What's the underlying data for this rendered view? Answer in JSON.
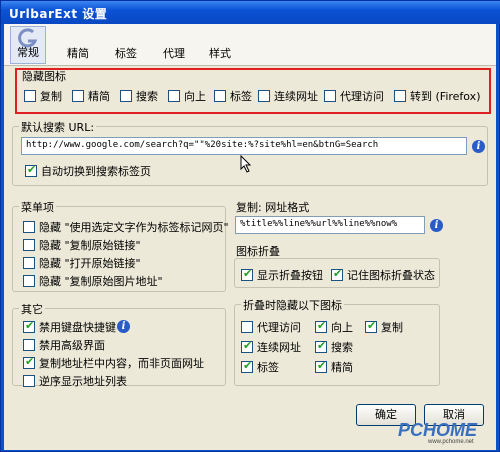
{
  "window": {
    "title": "UrlbarExt 设置"
  },
  "toolbar": {
    "tabs": [
      {
        "label": "常规",
        "active": true
      },
      {
        "label": "精简"
      },
      {
        "label": "标签"
      },
      {
        "label": "代理"
      },
      {
        "label": "样式"
      }
    ]
  },
  "hide_icons": {
    "title": "隐藏图标",
    "items": [
      {
        "label": "复制",
        "checked": false
      },
      {
        "label": "精简",
        "checked": false
      },
      {
        "label": "搜索",
        "checked": false
      },
      {
        "label": "向上",
        "checked": false
      },
      {
        "label": "标签",
        "checked": false
      },
      {
        "label": "连续网址",
        "checked": false
      },
      {
        "label": "代理访问",
        "checked": false
      },
      {
        "label": "转到 (Firefox)",
        "checked": false
      }
    ]
  },
  "search": {
    "title": "默认搜索 URL:",
    "url": "http://www.google.com/search?q=\"\"%20site:%?site%hl=en&btnG=Search",
    "auto_switch": {
      "label": "自动切换到搜索标签页",
      "checked": true
    }
  },
  "menu_items": {
    "title": "菜单项",
    "items": [
      {
        "label": "隐藏 \"使用选定文字作为标签标记网页\"",
        "checked": false
      },
      {
        "label": "隐藏 \"复制原始链接\"",
        "checked": false
      },
      {
        "label": "隐藏 \"打开原始链接\"",
        "checked": false
      },
      {
        "label": "隐藏 \"复制原始图片地址\"",
        "checked": false
      }
    ]
  },
  "copy_format": {
    "title": "复制: 网址格式",
    "value": "%title%%line%%url%%line%%now%"
  },
  "icon_fold": {
    "title": "图标折叠",
    "show_fold_button": {
      "label": "显示折叠按钮",
      "checked": true
    },
    "remember_state": {
      "label": "记住图标折叠状态",
      "checked": true
    }
  },
  "fold_hide": {
    "title": "折叠时隐藏以下图标",
    "items": [
      {
        "label": "代理访问",
        "checked": false
      },
      {
        "label": "向上",
        "checked": true
      },
      {
        "label": "复制",
        "checked": true
      },
      {
        "label": "连续网址",
        "checked": true
      },
      {
        "label": "搜索",
        "checked": true
      },
      {
        "label": "标签",
        "checked": true
      },
      {
        "label": "精简",
        "checked": true
      }
    ]
  },
  "other": {
    "title": "其它",
    "items": [
      {
        "label": "禁用键盘快捷键",
        "checked": true
      },
      {
        "label": "禁用高级界面",
        "checked": false
      },
      {
        "label": "复制地址栏中内容，而非页面网址",
        "checked": true
      },
      {
        "label": "逆序显示地址列表",
        "checked": false
      }
    ]
  },
  "buttons": {
    "ok": "确定",
    "cancel": "取消"
  },
  "watermark": {
    "text": "PCHOME",
    "sub": "www.pchome.net"
  },
  "colors": {
    "titlebar": "#0a52d6",
    "highlight_border": "#e02020",
    "dialog_bg": "#ece9d8"
  }
}
